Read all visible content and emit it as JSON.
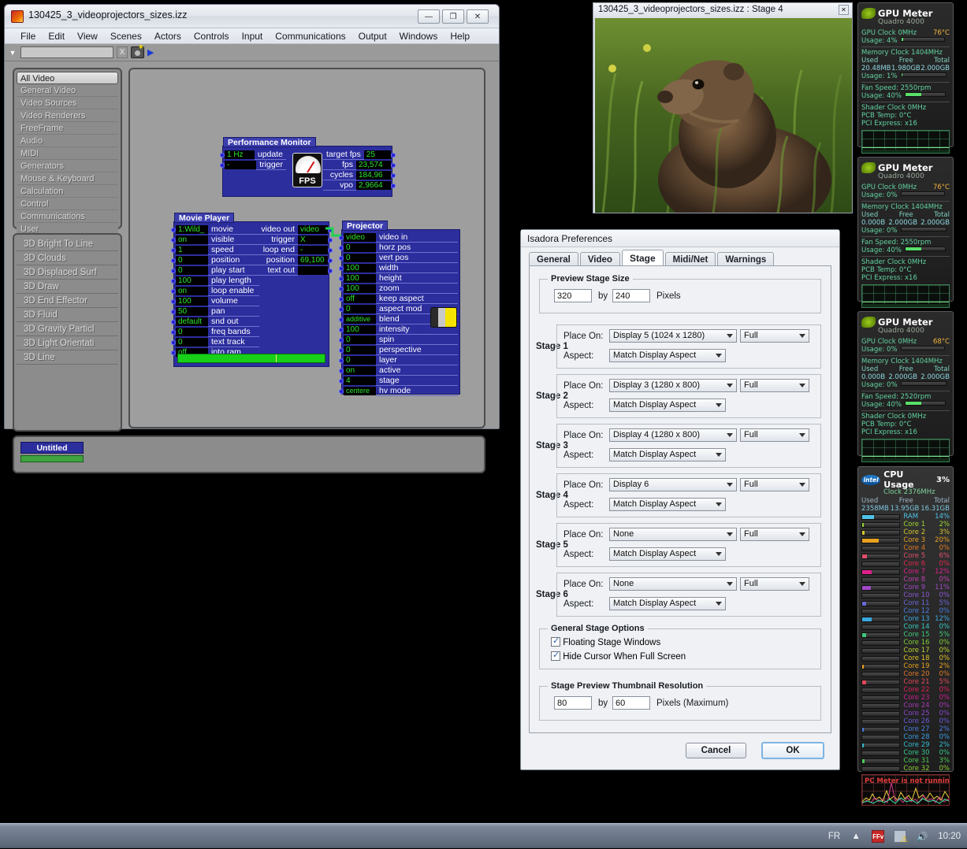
{
  "isadora": {
    "title": "130425_3_videoprojectors_sizes.izz",
    "window_buttons": {
      "minimize": "—",
      "maximize": "❐",
      "close": "✕"
    },
    "menus": [
      "File",
      "Edit",
      "View",
      "Scenes",
      "Actors",
      "Controls",
      "Input",
      "Communications",
      "Output",
      "Windows",
      "Help"
    ],
    "toolbar": {
      "search_value": "",
      "clear_label": "X"
    },
    "categories": [
      "All Video",
      "General Video",
      "Video Sources",
      "Video Renderers",
      "FreeFrame",
      "Audio",
      "MIDI",
      "Generators",
      "Mouse & Keyboard",
      "Calculation",
      "Control",
      "Communications",
      "User"
    ],
    "selected_category": "All Video",
    "actors": [
      "3D Bright To Line",
      "3D Clouds",
      "3D Displaced Surf",
      "3D Draw",
      "3D End Effector",
      "3D Fluid",
      "3D Gravity Particl",
      "3D Light Orientati",
      "3D Line"
    ],
    "scene": {
      "name": "Untitled"
    }
  },
  "nodes": {
    "performance_monitor": {
      "title": "Performance Monitor",
      "gauge_label": "FPS",
      "inputs": [
        {
          "value": "1 Hz",
          "label": "update"
        },
        {
          "value": "-",
          "label": "trigger"
        }
      ],
      "outputs": [
        {
          "label": "target fps",
          "value": "25"
        },
        {
          "label": "fps",
          "value": "23,574"
        },
        {
          "label": "cycles",
          "value": "184,96"
        },
        {
          "label": "vpo",
          "value": "2,9664"
        }
      ]
    },
    "movie_player": {
      "title": "Movie Player",
      "inputs": [
        {
          "value": "1:Wild_",
          "label": "movie"
        },
        {
          "value": "on",
          "label": "visible"
        },
        {
          "value": "1",
          "label": "speed"
        },
        {
          "value": "0",
          "label": "position"
        },
        {
          "value": "0",
          "label": "play start"
        },
        {
          "value": "100",
          "label": "play length"
        },
        {
          "value": "on",
          "label": "loop enable"
        },
        {
          "value": "100",
          "label": "volume"
        },
        {
          "value": "50",
          "label": "pan"
        },
        {
          "value": "default",
          "label": "snd out"
        },
        {
          "value": "0",
          "label": "freq bands"
        },
        {
          "value": "0",
          "label": "text track"
        },
        {
          "value": "off",
          "label": "into ram"
        }
      ],
      "outputs": [
        {
          "label": "video out",
          "value": "video"
        },
        {
          "label": "trigger",
          "value": "X"
        },
        {
          "label": "loop end",
          "value": "-"
        },
        {
          "label": "position",
          "value": "69,100"
        },
        {
          "label": "text out",
          "value": ""
        }
      ]
    },
    "projector": {
      "title": "Projector",
      "inputs": [
        {
          "value": "video",
          "label": "video in"
        },
        {
          "value": "0",
          "label": "horz pos"
        },
        {
          "value": "0",
          "label": "vert pos"
        },
        {
          "value": "100",
          "label": "width"
        },
        {
          "value": "100",
          "label": "height"
        },
        {
          "value": "100",
          "label": "zoom"
        },
        {
          "value": "off",
          "label": "keep aspect"
        },
        {
          "value": "0",
          "label": "aspect mod"
        },
        {
          "value": "additive",
          "label": "blend"
        },
        {
          "value": "100",
          "label": "intensity"
        },
        {
          "value": "0",
          "label": "spin"
        },
        {
          "value": "0",
          "label": "perspective"
        },
        {
          "value": "0",
          "label": "layer"
        },
        {
          "value": "on",
          "label": "active"
        },
        {
          "value": "4",
          "label": "stage"
        },
        {
          "value": "centere",
          "label": "hv mode"
        }
      ]
    }
  },
  "stage_window": {
    "title": "130425_3_videoprojectors_sizes.izz : Stage 4",
    "close_label": "✕"
  },
  "prefs": {
    "title": "Isadora Preferences",
    "tabs": [
      {
        "label": "General",
        "active": false
      },
      {
        "label": "Video",
        "active": false
      },
      {
        "label": "Stage",
        "active": true
      },
      {
        "label": "Midi/Net",
        "active": false
      },
      {
        "label": "Warnings",
        "active": false
      }
    ],
    "preview_stage_size": {
      "legend": "Preview Stage Size",
      "width": "320",
      "by": "by",
      "height": "240",
      "units": "Pixels"
    },
    "place_on_label": "Place On:",
    "aspect_label": "Aspect:",
    "stages": [
      {
        "name": "Stage 1",
        "place_on": "Display 5 (1024 x 1280)",
        "mode": "Full",
        "aspect": "Match Display Aspect"
      },
      {
        "name": "Stage 2",
        "place_on": "Display 3 (1280 x 800)",
        "mode": "Full",
        "aspect": "Match Display Aspect"
      },
      {
        "name": "Stage 3",
        "place_on": "Display 4 (1280 x 800)",
        "mode": "Full",
        "aspect": "Match Display Aspect"
      },
      {
        "name": "Stage 4",
        "place_on": "Display 6",
        "mode": "Full",
        "aspect": "Match Display Aspect"
      },
      {
        "name": "Stage 5",
        "place_on": "None",
        "mode": "Full",
        "aspect": "Match Display Aspect"
      },
      {
        "name": "Stage 6",
        "place_on": "None",
        "mode": "Full",
        "aspect": "Match Display Aspect"
      }
    ],
    "general_stage_options": {
      "legend": "General Stage Options",
      "floating": "Floating Stage Windows",
      "hide_cursor": "Hide Cursor When Full Screen"
    },
    "thumbnail": {
      "legend": "Stage Preview Thumbnail Resolution",
      "width": "80",
      "by": "by",
      "height": "60",
      "units": "Pixels (Maximum)"
    },
    "cancel": "Cancel",
    "ok": "OK"
  },
  "gpu_meters": [
    {
      "title": "GPU Meter",
      "model": "Quadro 4000",
      "gpu_clock": "GPU Clock 0MHz",
      "temp": "76°C",
      "gpu_usage": "Usage: 4%",
      "gpu_usage_pct": 4,
      "memory_clock": "Memory Clock 1404MHz",
      "col_used": "Used",
      "col_free": "Free",
      "col_total": "Total",
      "used": "20.48MB",
      "free": "1.980GB",
      "total": "2.000GB",
      "mem_usage": "Usage: 1%",
      "mem_usage_pct": 1,
      "fan_speed": "Fan Speed: 2550rpm",
      "fan_usage": "Usage: 40%",
      "fan_usage_pct": 40,
      "shader_clock": "Shader Clock 0MHz",
      "pcb_temp": "PCB Temp: 0°C",
      "pci": "PCI Express: x16"
    },
    {
      "title": "GPU Meter",
      "model": "Quadro 4000",
      "gpu_clock": "GPU Clock 0MHz",
      "temp": "76°C",
      "gpu_usage": "Usage: 0%",
      "gpu_usage_pct": 0,
      "memory_clock": "Memory Clock 1404MHz",
      "col_used": "Used",
      "col_free": "Free",
      "col_total": "Total",
      "used": "0.000B",
      "free": "2.000GB",
      "total": "2.000GB",
      "mem_usage": "Usage: 0%",
      "mem_usage_pct": 0,
      "fan_speed": "Fan Speed: 2550rpm",
      "fan_usage": "Usage: 40%",
      "fan_usage_pct": 40,
      "shader_clock": "Shader Clock 0MHz",
      "pcb_temp": "PCB Temp: 0°C",
      "pci": "PCI Express: x16"
    },
    {
      "title": "GPU Meter",
      "model": "Quadro 4000",
      "gpu_clock": "GPU Clock 0MHz",
      "temp": "68°C",
      "gpu_usage": "Usage: 0%",
      "gpu_usage_pct": 0,
      "memory_clock": "Memory Clock 1404MHz",
      "col_used": "Used",
      "col_free": "Free",
      "col_total": "Total",
      "used": "0.000B",
      "free": "2.000GB",
      "total": "2.000GB",
      "mem_usage": "Usage: 0%",
      "mem_usage_pct": 0,
      "fan_speed": "Fan Speed: 2520rpm",
      "fan_usage": "Usage: 40%",
      "fan_usage_pct": 40,
      "shader_clock": "Shader Clock 0MHz",
      "pcb_temp": "PCB Temp: 0°C",
      "pci": "PCI Express: x16"
    }
  ],
  "cpu_gadget": {
    "brand": "intel",
    "title": "CPU Usage",
    "total_pct": "3%",
    "clock": "Clock 2376MHz",
    "col_used": "Used",
    "col_free": "Free",
    "col_total": "Total",
    "used": "2358MB",
    "free": "13.95GB",
    "total": "16.31GB",
    "rows": [
      {
        "name": "RAM",
        "pct": "14%",
        "value": 14,
        "color": "#4fc3e8"
      },
      {
        "name": "Core 1",
        "pct": "2%",
        "value": 2,
        "color": "#9bd62e"
      },
      {
        "name": "Core 2",
        "pct": "3%",
        "value": 3,
        "color": "#d6c72e"
      },
      {
        "name": "Core 3",
        "pct": "20%",
        "value": 20,
        "color": "#e8a020"
      },
      {
        "name": "Core 4",
        "pct": "0%",
        "value": 0,
        "color": "#e07b20"
      },
      {
        "name": "Core 5",
        "pct": "6%",
        "value": 6,
        "color": "#e0506a"
      },
      {
        "name": "Core 6",
        "pct": "0%",
        "value": 0,
        "color": "#e02850"
      },
      {
        "name": "Core 7",
        "pct": "12%",
        "value": 12,
        "color": "#e0208c"
      },
      {
        "name": "Core 8",
        "pct": "0%",
        "value": 0,
        "color": "#c040b0"
      },
      {
        "name": "Core 9",
        "pct": "11%",
        "value": 11,
        "color": "#a048c8"
      },
      {
        "name": "Core 10",
        "pct": "0%",
        "value": 0,
        "color": "#8a58d0"
      },
      {
        "name": "Core 11",
        "pct": "5%",
        "value": 5,
        "color": "#6a68d8"
      },
      {
        "name": "Core 12",
        "pct": "0%",
        "value": 0,
        "color": "#4a7ce0"
      },
      {
        "name": "Core 13",
        "pct": "12%",
        "value": 12,
        "color": "#3aa8e0"
      },
      {
        "name": "Core 14",
        "pct": "0%",
        "value": 0,
        "color": "#35c8c0"
      },
      {
        "name": "Core 15",
        "pct": "5%",
        "value": 5,
        "color": "#3fc97a"
      },
      {
        "name": "Core 16",
        "pct": "0%",
        "value": 0,
        "color": "#7fcf35"
      },
      {
        "name": "Core 17",
        "pct": "0%",
        "value": 0,
        "color": "#b8d42e"
      },
      {
        "name": "Core 18",
        "pct": "0%",
        "value": 0,
        "color": "#e0c028"
      },
      {
        "name": "Core 19",
        "pct": "2%",
        "value": 2,
        "color": "#e8a020"
      },
      {
        "name": "Core 20",
        "pct": "0%",
        "value": 0,
        "color": "#e07828"
      },
      {
        "name": "Core 21",
        "pct": "5%",
        "value": 5,
        "color": "#e04a58"
      },
      {
        "name": "Core 22",
        "pct": "0%",
        "value": 0,
        "color": "#e02058"
      },
      {
        "name": "Core 23",
        "pct": "0%",
        "value": 0,
        "color": "#cc2090"
      },
      {
        "name": "Core 24",
        "pct": "0%",
        "value": 0,
        "color": "#a838b8"
      },
      {
        "name": "Core 25",
        "pct": "0%",
        "value": 0,
        "color": "#8a48cc"
      },
      {
        "name": "Core 26",
        "pct": "0%",
        "value": 0,
        "color": "#6a5cd8"
      },
      {
        "name": "Core 27",
        "pct": "2%",
        "value": 2,
        "color": "#4a7ce0"
      },
      {
        "name": "Core 28",
        "pct": "0%",
        "value": 0,
        "color": "#3a9ce0"
      },
      {
        "name": "Core 29",
        "pct": "2%",
        "value": 2,
        "color": "#33bcd0"
      },
      {
        "name": "Core 30",
        "pct": "0%",
        "value": 0,
        "color": "#35c98e"
      },
      {
        "name": "Core 31",
        "pct": "3%",
        "value": 3,
        "color": "#4ecb5a"
      },
      {
        "name": "Core 32",
        "pct": "0%",
        "value": 0,
        "color": "#8ccf35"
      }
    ],
    "graph_message": "PC Meter is not running!"
  },
  "taskbar": {
    "language": "FR",
    "show_hidden": "▲",
    "icons": [
      "ffv-icon",
      "network-warning-icon",
      "volume-icon"
    ],
    "clock": "10:20"
  }
}
